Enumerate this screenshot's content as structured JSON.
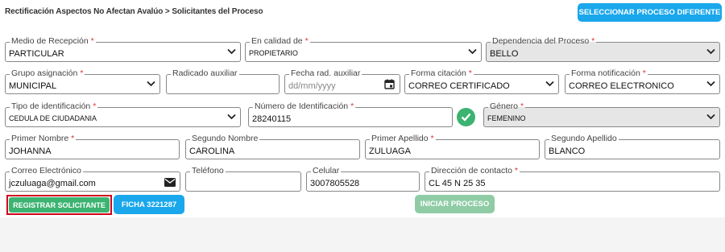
{
  "header": {
    "breadcrumb": "Rectificación Aspectos No Afectan Avalúo > Solicitantes del Proceso",
    "select_process_button": "SELECCIONAR PROCESO DIFERENTE"
  },
  "form": {
    "medio_recepcion": {
      "label": "Medio de Recepción",
      "value": "PARTICULAR"
    },
    "calidad": {
      "label": "En calidad de",
      "value": "PROPIETARIO"
    },
    "dependencia": {
      "label": "Dependencia del Proceso",
      "value": "BELLO"
    },
    "grupo_asignacion": {
      "label": "Grupo asignación",
      "value": "MUNICIPAL"
    },
    "radicado_auxiliar": {
      "label": "Radicado auxiliar",
      "value": ""
    },
    "fecha_rad_auxiliar": {
      "label": "Fecha rad. auxiliar",
      "placeholder": "dd/mm/yyyy"
    },
    "forma_citacion": {
      "label": "Forma citación",
      "value": "CORREO CERTIFICADO"
    },
    "forma_notificacion": {
      "label": "Forma notificación",
      "value": "CORREO ELECTRONICO"
    },
    "tipo_identificacion": {
      "label": "Tipo de identificación",
      "value": "CEDULA DE CIUDADANIA"
    },
    "numero_identificacion": {
      "label": "Número de Identificación",
      "value": "28240115"
    },
    "genero": {
      "label": "Género",
      "value": "FEMENINO"
    },
    "primer_nombre": {
      "label": "Primer Nombre",
      "value": "JOHANNA"
    },
    "segundo_nombre": {
      "label": "Segundo Nombre",
      "value": "CAROLINA"
    },
    "primer_apellido": {
      "label": "Primer Apellido",
      "value": "ZULUAGA"
    },
    "segundo_apellido": {
      "label": "Segundo Apellido",
      "value": "BLANCO"
    },
    "correo": {
      "label": "Correo Electrónico",
      "value": "jczuluaga@gmail.com"
    },
    "telefono": {
      "label": "Teléfono",
      "value": ""
    },
    "celular": {
      "label": "Celular",
      "value": "3007805528"
    },
    "direccion": {
      "label": "Dirección de contacto",
      "value": "CL 45 N 25 35"
    }
  },
  "actions": {
    "register": "REGISTRAR SOLICITANTE",
    "ficha": "FICHA 3221287",
    "iniciar": "INICIAR PROCESO"
  },
  "icons": {
    "select_arrow": "chevron-down-icon",
    "date": "calendar-icon",
    "email": "envelope-icon",
    "validated": "check-circle-icon"
  },
  "colors": {
    "primary_blue": "#1aa7ec",
    "success_green": "#3cb371",
    "required_red": "#d33333",
    "highlight_red": "#d0021b"
  }
}
